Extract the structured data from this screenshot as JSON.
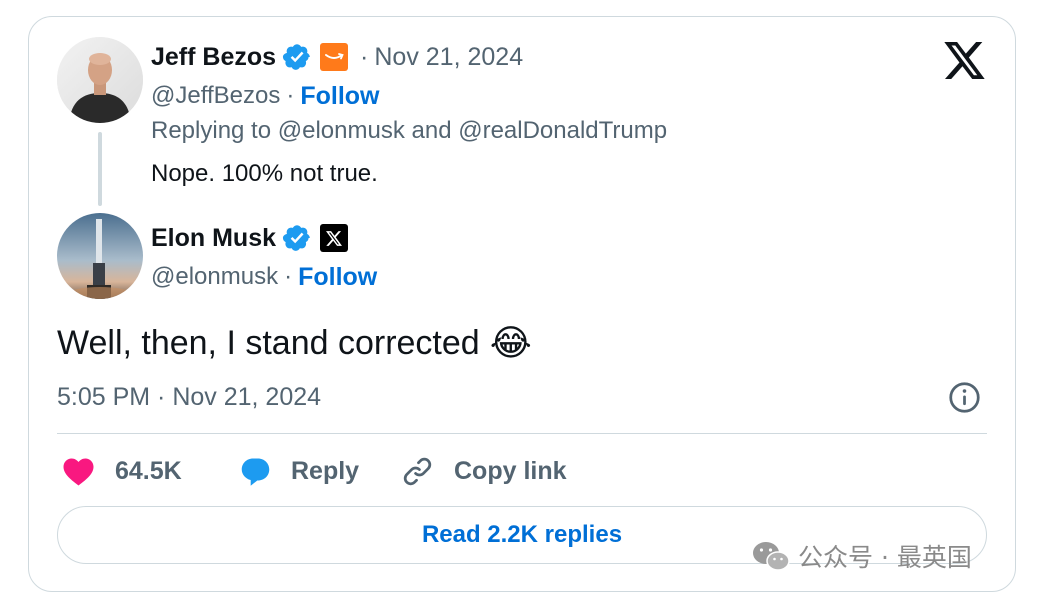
{
  "quoted_tweet": {
    "author_name": "Jeff Bezos",
    "handle": "@JeffBezos",
    "follow_label": "Follow",
    "separator": "·",
    "date": "Nov 21, 2024",
    "replying_prefix": "Replying to",
    "replying_user1": "@elonmusk",
    "replying_and": "and",
    "replying_user2": "@realDonaldTrump",
    "text": "Nope. 100% not true."
  },
  "main_tweet": {
    "author_name": "Elon Musk",
    "handle": "@elonmusk",
    "follow_label": "Follow",
    "separator": "·",
    "text": "Well, then, I stand corrected",
    "emoji": "😂",
    "timestamp": "5:05 PM · Nov 21, 2024"
  },
  "actions": {
    "like_count": "64.5K",
    "reply_label": "Reply",
    "copy_link_label": "Copy link"
  },
  "read_replies_label": "Read 2.2K replies",
  "watermark": {
    "text": "公众号 · 最英国"
  },
  "icons": {
    "verified": "verified-badge-icon",
    "amazon": "amazon-logo-icon",
    "x_affiliate": "x-logo-icon",
    "x_logo": "x-logo-icon",
    "info": "info-icon",
    "heart": "heart-icon",
    "reply": "reply-bubble-icon",
    "link": "link-icon",
    "wechat": "wechat-icon"
  },
  "colors": {
    "verified_blue": "#1d9bf0",
    "link_blue": "#006fd6",
    "heart_pink": "#f91880",
    "muted_gray": "#536471",
    "amazon_orange": "#ff9900"
  }
}
